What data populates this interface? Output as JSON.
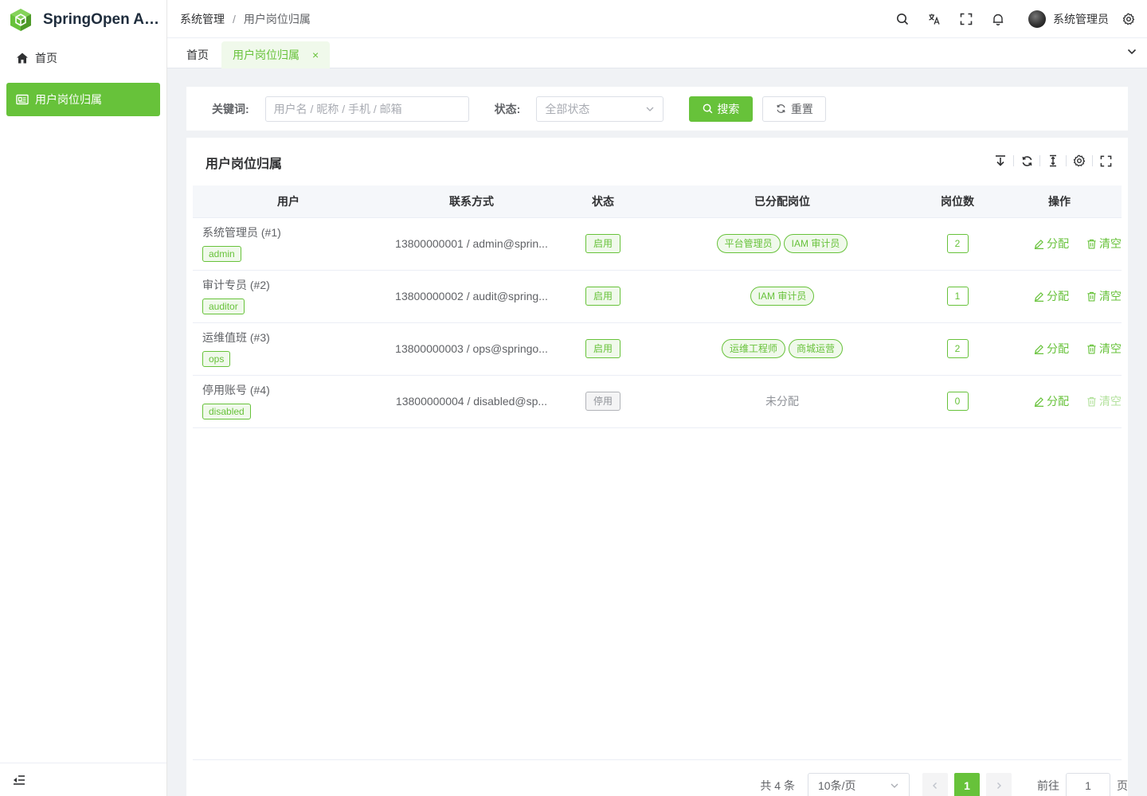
{
  "app": {
    "name": "SpringOpen Admin",
    "brand_color": "#67c23a"
  },
  "sidebar": {
    "items": [
      {
        "label": "首页",
        "icon": "home-icon",
        "active": false
      },
      {
        "label": "用户岗位归属",
        "icon": "id-card-icon",
        "active": true
      }
    ],
    "collapse_icon": "outdent-icon"
  },
  "header": {
    "breadcrumb": [
      "系统管理",
      "用户岗位归属"
    ],
    "separator": "/",
    "icons": [
      "search-icon",
      "translate-icon",
      "fullscreen-icon",
      "bell-icon",
      "settings-icon"
    ],
    "user_name": "系统管理员"
  },
  "tabs": [
    {
      "label": "首页",
      "active": false
    },
    {
      "label": "用户岗位归属",
      "active": true,
      "close": "×"
    }
  ],
  "search": {
    "keyword_label": "关键词:",
    "keyword_placeholder": "用户名 / 昵称 / 手机 / 邮箱",
    "status_label": "状态:",
    "status_placeholder": "全部状态",
    "search_button": "搜索",
    "reset_button": "重置"
  },
  "table": {
    "title": "用户岗位归属",
    "columns": [
      "用户",
      "联系方式",
      "状态",
      "已分配岗位",
      "岗位数",
      "操作"
    ],
    "rows": [
      {
        "name": "系统管理员 (#1)",
        "username": "admin",
        "contact": "13800000001 / admin@sprin...",
        "status": "启用",
        "enabled": true,
        "positions": [
          "平台管理员",
          "IAM 审计员"
        ],
        "count": "2",
        "assign": "分配",
        "clear": "清空"
      },
      {
        "name": "审计专员 (#2)",
        "username": "auditor",
        "contact": "13800000002 / audit@spring...",
        "status": "启用",
        "enabled": true,
        "positions": [
          "IAM 审计员"
        ],
        "count": "1",
        "assign": "分配",
        "clear": "清空"
      },
      {
        "name": "运维值班 (#3)",
        "username": "ops",
        "contact": "13800000003 / ops@springo...",
        "status": "启用",
        "enabled": true,
        "positions": [
          "运维工程师",
          "商城运营"
        ],
        "count": "2",
        "assign": "分配",
        "clear": "清空"
      },
      {
        "name": "停用账号 (#4)",
        "username": "disabled",
        "contact": "13800000004 / disabled@sp...",
        "status": "停用",
        "enabled": false,
        "positions": [],
        "unassigned": "未分配",
        "count": "0",
        "assign": "分配",
        "clear": "清空"
      }
    ]
  },
  "pagination": {
    "total_text": "共 4 条",
    "page_size": "10条/页",
    "current_page": "1",
    "goto_label": "前往",
    "goto_value": "1",
    "page_suffix": "页"
  }
}
